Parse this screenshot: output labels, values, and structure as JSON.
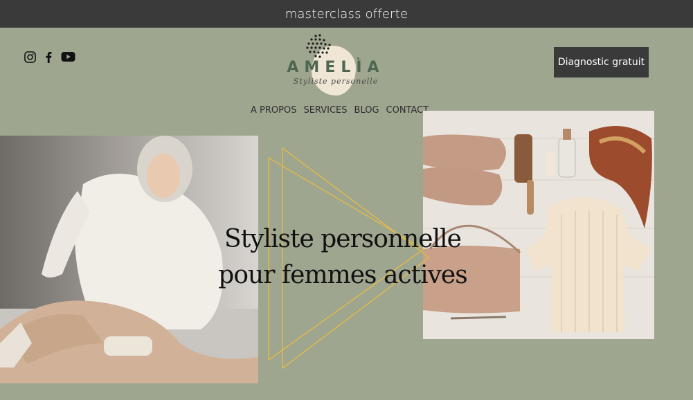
{
  "announcement": {
    "text": "masterclass offerte"
  },
  "social": {
    "icons": [
      "instagram-icon",
      "facebook-icon",
      "youtube-icon"
    ]
  },
  "logo": {
    "brand": "AMELÌA",
    "tagline": "Styliste personelle"
  },
  "cta": {
    "label": "Diagnostic gratuit"
  },
  "nav": {
    "items": [
      {
        "label": "A PROPOS"
      },
      {
        "label": "SERVICES"
      },
      {
        "label": "BLOG"
      },
      {
        "label": "CONTACT"
      }
    ]
  },
  "hero": {
    "line1": "Styliste personnelle",
    "line2": "pour femmes actives"
  },
  "colors": {
    "background": "#9ea690",
    "dark": "#3a3a3a",
    "accent_gold": "#e0b94a",
    "brand_green": "#4f6650",
    "blob_cream": "#efe6d6"
  }
}
